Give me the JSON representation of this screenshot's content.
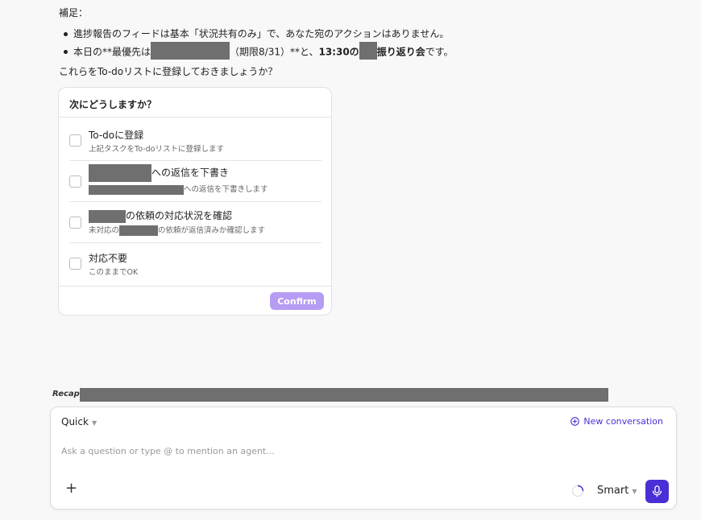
{
  "message": {
    "heading": "補足：",
    "bullet1": "進捗報告のフィードは基本「状況共有のみ」で、あなた宛のアクションはありません。",
    "bullet2_pre": "本日の**最優先は",
    "bullet2_mid": "（期限8/31）**と、",
    "bullet2_time": "13:30の",
    "bullet2_event": "振り返り会",
    "bullet2_end": "です。",
    "question": "これらをTo-doリストに登録しておきましょうか？"
  },
  "card": {
    "title": "次にどうしますか？",
    "options": [
      {
        "title": "To-doに登録",
        "sub": "上記タスクをTo-doリストに登録します"
      },
      {
        "title": "への返信を下書き",
        "sub": "への返信を下書きします"
      },
      {
        "title": "の依頼の対応状況を確認",
        "sub_pre": "未対応の",
        "sub": "の依頼が返信済みか確認します"
      },
      {
        "title": "対応不要",
        "sub": "このままでOK"
      }
    ],
    "confirm_label": "Confirm"
  },
  "recap": {
    "label": "Recap:"
  },
  "input": {
    "mode": "Quick",
    "new_conversation": "New conversation",
    "placeholder": "Ask a question or type @ to mention an agent...",
    "model": "Smart"
  },
  "colors": {
    "accent": "#4a2fd6",
    "confirm_disabled": "#b79cf3",
    "redaction": "#6f6f6f"
  }
}
